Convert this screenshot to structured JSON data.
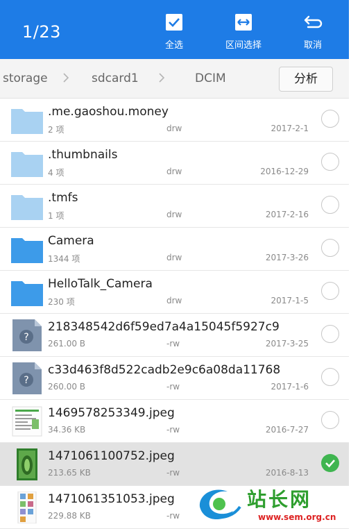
{
  "header": {
    "counter": "1/23",
    "actions": [
      {
        "label": "全选",
        "icon": "select-all-icon"
      },
      {
        "label": "区间选择",
        "icon": "range-select-icon"
      },
      {
        "label": "取消",
        "icon": "cancel-icon"
      }
    ],
    "accent": "#1e7ce6"
  },
  "breadcrumb": {
    "items": [
      "storage",
      "sdcard1",
      "DCIM"
    ],
    "analyze_label": "分析"
  },
  "files": [
    {
      "name": ".me.gaoshou.money",
      "sub": "2 项",
      "perm": "drw",
      "date": "2017-2-1",
      "type": "folder-light",
      "checked": false
    },
    {
      "name": ".thumbnails",
      "sub": "4 项",
      "perm": "drw",
      "date": "2016-12-29",
      "type": "folder-light",
      "checked": false
    },
    {
      "name": ".tmfs",
      "sub": "1 项",
      "perm": "drw",
      "date": "2017-2-16",
      "type": "folder-light",
      "checked": false
    },
    {
      "name": "Camera",
      "sub": "1344 项",
      "perm": "drw",
      "date": "2017-3-26",
      "type": "folder",
      "checked": false
    },
    {
      "name": "HelloTalk_Camera",
      "sub": "230 项",
      "perm": "drw",
      "date": "2017-1-5",
      "type": "folder",
      "checked": false
    },
    {
      "name": "218348542d6f59ed7a4a15045f5927c9",
      "sub": "261.00 B",
      "perm": "-rw",
      "date": "2017-3-25",
      "type": "unknown",
      "checked": false
    },
    {
      "name": "c33d463f8d522cadb2e9c6a08da11768",
      "sub": "260.00 B",
      "perm": "-rw",
      "date": "2017-1-6",
      "type": "unknown",
      "checked": false
    },
    {
      "name": "1469578253349.jpeg",
      "sub": "34.36 KB",
      "perm": "-rw",
      "date": "2016-7-27",
      "type": "image-doc",
      "checked": false
    },
    {
      "name": "1471061100752.jpeg",
      "sub": "213.65 KB",
      "perm": "-rw",
      "date": "2016-8-13",
      "type": "image-green",
      "checked": true
    },
    {
      "name": "1471061351053.jpeg",
      "sub": "229.88 KB",
      "perm": "-rw",
      "date": "",
      "type": "image-grid",
      "checked": false
    }
  ],
  "watermark": {
    "text": "站长网",
    "url": "www.sem.org.cn"
  }
}
